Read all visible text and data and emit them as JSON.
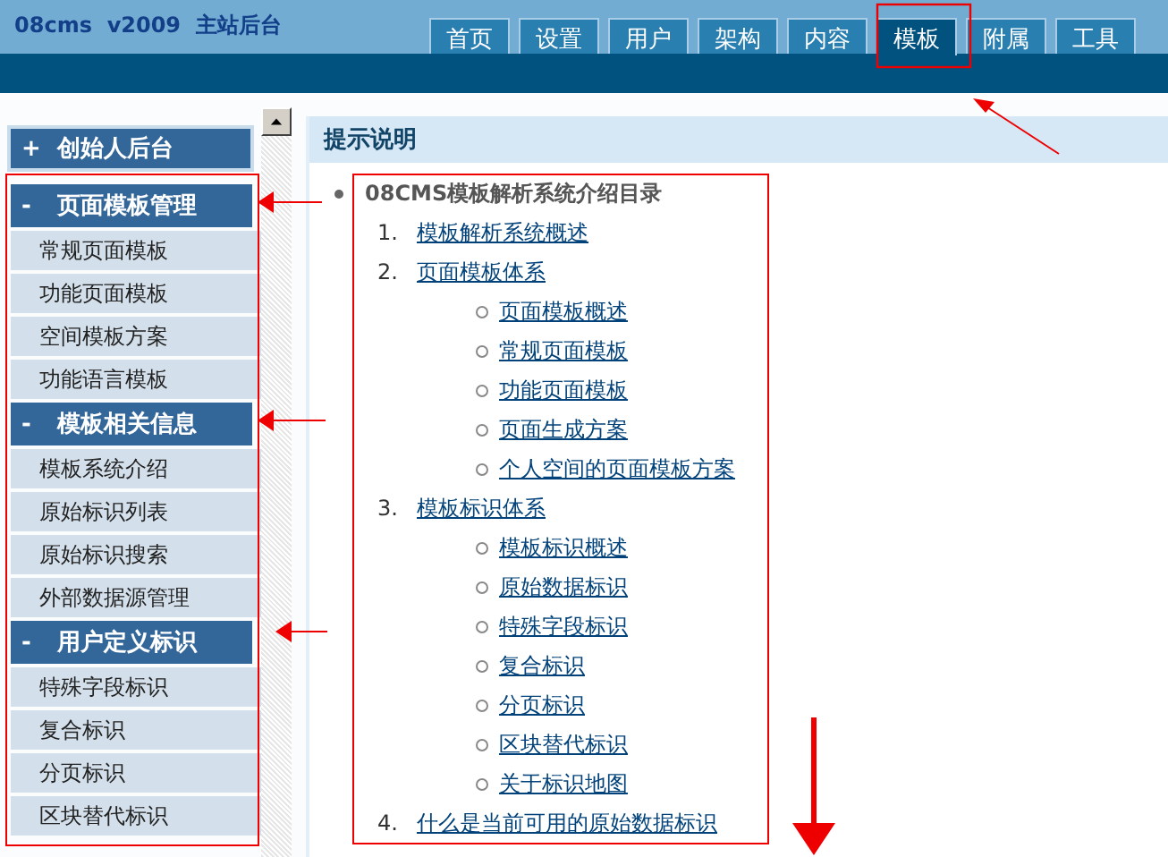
{
  "header": {
    "title": "08cms  v2009  主站后台"
  },
  "tabs": [
    {
      "label": "首页",
      "selected": false
    },
    {
      "label": "设置",
      "selected": false
    },
    {
      "label": "用户",
      "selected": false
    },
    {
      "label": "架构",
      "selected": false
    },
    {
      "label": "内容",
      "selected": false
    },
    {
      "label": "模板",
      "selected": true
    },
    {
      "label": "附属",
      "selected": false
    },
    {
      "label": "工具",
      "selected": false
    }
  ],
  "sidebar": {
    "top_item": {
      "sign": "+",
      "label": "创始人后台"
    },
    "groups": [
      {
        "sign": "-",
        "label": "页面模板管理",
        "items": [
          "常规页面模板",
          "功能页面模板",
          "空间模板方案",
          "功能语言模板"
        ]
      },
      {
        "sign": "-",
        "label": "模板相关信息",
        "items": [
          "模板系统介绍",
          "原始标识列表",
          "原始标识搜索",
          "外部数据源管理"
        ]
      },
      {
        "sign": "-",
        "label": "用户定义标识",
        "items": [
          "特殊字段标识",
          "复合标识",
          "分页标识",
          "区块替代标识"
        ]
      }
    ]
  },
  "panel": {
    "title": "提示说明",
    "toc_title": "08CMS模板解析系统介绍目录",
    "sections": [
      {
        "number": "1.",
        "label": "模板解析系统概述"
      },
      {
        "number": "2.",
        "label": "页面模板体系",
        "children": [
          "页面模板概述",
          "常规页面模板",
          "功能页面模板",
          "页面生成方案",
          "个人空间的页面模板方案"
        ]
      },
      {
        "number": "3.",
        "label": "模板标识体系",
        "children": [
          "模板标识概述",
          "原始数据标识",
          "特殊字段标识",
          "复合标识",
          "分页标识",
          "区块替代标识",
          "关于标识地图"
        ]
      },
      {
        "number": "4.",
        "label": "什么是当前可用的原始数据标识"
      }
    ]
  }
}
